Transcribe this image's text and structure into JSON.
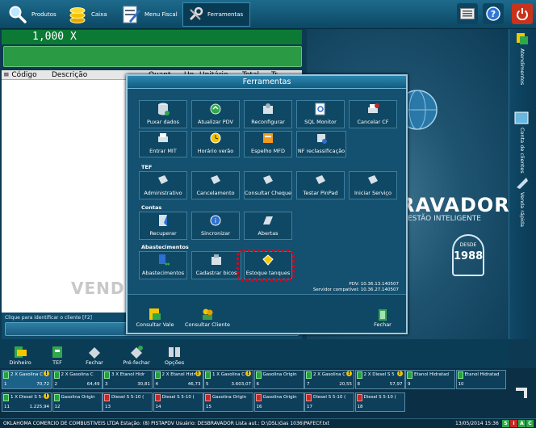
{
  "toolbar": {
    "produtos": "Produtos",
    "caixa": "Caixa",
    "menu_fiscal": "Menu Fiscal",
    "ferramentas": "Ferramentas"
  },
  "qty": "1,000  X",
  "list": {
    "headers": [
      "≡ Código",
      "Descrição",
      "Quant.",
      "Un.",
      "Unitário",
      "Total",
      "Tr."
    ]
  },
  "watermark": "VEND",
  "brand": {
    "name": "RAVADOR",
    "suffix": "®",
    "tagline": "GESTÃO INTELIGENTE",
    "since_top": "DESDE",
    "since_year": "1988"
  },
  "sidebar": {
    "tabs": [
      "Atendimentos",
      "Conta de clientes",
      "Venda rápida"
    ]
  },
  "client_hint": "Clique para identificar o cliente [F2]",
  "actions": [
    "Dinheiro",
    "TEF",
    "Fechar",
    "Pré-fechar",
    "Opções"
  ],
  "dialog": {
    "title": "Ferramentas",
    "row1": [
      "Puxar dados",
      "Atualizar PDV",
      "Reconfigurar",
      "SQL Monitor",
      "Cancelar CF"
    ],
    "row2": [
      "Entrar MIT",
      "Horário verão",
      "Espelho MFD",
      "NF reclassificação"
    ],
    "tef_label": "TEF",
    "tef": [
      "Administrativo",
      "Cancelamento",
      "Consultar Cheque",
      "Testar PinPad",
      "Iniciar Serviço"
    ],
    "contas_label": "Contas",
    "contas": [
      "Recuperar",
      "Sincronizar",
      "Abertas"
    ],
    "abast_label": "Abastecimentos",
    "abast": [
      "Abastecimentos",
      "Cadastrar bicos",
      "Estoque tanques"
    ],
    "pdv": "PDV: 10.36.13.140507",
    "servidor": "Servidor compatível: 10.36.27.140507",
    "footer": [
      "Consultar Vale",
      "Consultar Cliente",
      "Fechar"
    ]
  },
  "pumps_row1": [
    {
      "name": "2 X Gasolina C",
      "n": "1",
      "v": "70,72",
      "red": false,
      "warn": true,
      "sel": true
    },
    {
      "name": "2 X Gasolina C",
      "n": "2",
      "v": "64,49",
      "red": false,
      "warn": false,
      "sel": false
    },
    {
      "name": "3 X Etanol Hidr",
      "n": "3",
      "v": "30,81",
      "red": false,
      "warn": false,
      "sel": false
    },
    {
      "name": "2 X Etanol Hidr",
      "n": "4",
      "v": "46,73",
      "red": false,
      "warn": true,
      "sel": false
    },
    {
      "name": "1 X Gasolina C",
      "n": "5",
      "v": "3.603,07",
      "red": false,
      "warn": true,
      "sel": false
    },
    {
      "name": "Gasolina Origin",
      "n": "6",
      "v": "",
      "red": false,
      "warn": false,
      "sel": false
    },
    {
      "name": "2 X Gasolina C",
      "n": "7",
      "v": "20,55",
      "red": false,
      "warn": true,
      "sel": false
    },
    {
      "name": "2 X Diesel S 5",
      "n": "8",
      "v": "57,97",
      "red": false,
      "warn": true,
      "sel": false
    },
    {
      "name": "Etanol Hidratad",
      "n": "9",
      "v": "",
      "red": false,
      "warn": false,
      "sel": false
    },
    {
      "name": "Etanol Hidratad",
      "n": "10",
      "v": "",
      "red": false,
      "warn": false,
      "sel": false
    }
  ],
  "pumps_row2": [
    {
      "name": "1 X Diesel S 5-",
      "n": "11",
      "v": "1.225,94",
      "red": false,
      "warn": true,
      "sel": false
    },
    {
      "name": "Gasolina Origin",
      "n": "12",
      "v": "",
      "red": false,
      "warn": false,
      "sel": false
    },
    {
      "name": "Diesel S 5-10 (",
      "n": "13",
      "v": "",
      "red": true,
      "warn": false,
      "sel": false
    },
    {
      "name": "Diesel S 5-10 (",
      "n": "14",
      "v": "",
      "red": true,
      "warn": false,
      "sel": false
    },
    {
      "name": "Gasolina Origin",
      "n": "15",
      "v": "",
      "red": true,
      "warn": false,
      "sel": false
    },
    {
      "name": "Gasolina Origin",
      "n": "16",
      "v": "",
      "red": true,
      "warn": false,
      "sel": false
    },
    {
      "name": "Diesel S 5-10 (",
      "n": "17",
      "v": "",
      "red": true,
      "warn": false,
      "sel": false
    },
    {
      "name": "Diesel S 5-10 (",
      "n": "18",
      "v": "",
      "red": true,
      "warn": false,
      "sel": false
    }
  ],
  "status": {
    "left": "OKLAHOMA COMERCIO DE COMBUSTIVEIS LTDA   Estação: (8) PISTAPDV   Usuário: DESBRAVADOR   Lista aut.: D:\\DSL\\Gas 1036\\PAFECF.txt",
    "datetime": "13/05/2014 15:36",
    "flags": [
      "S",
      "I",
      "A",
      "C"
    ]
  },
  "colors": {
    "accent": "#14506f",
    "highlight": "#e0001a",
    "green": "#0c7a35"
  }
}
